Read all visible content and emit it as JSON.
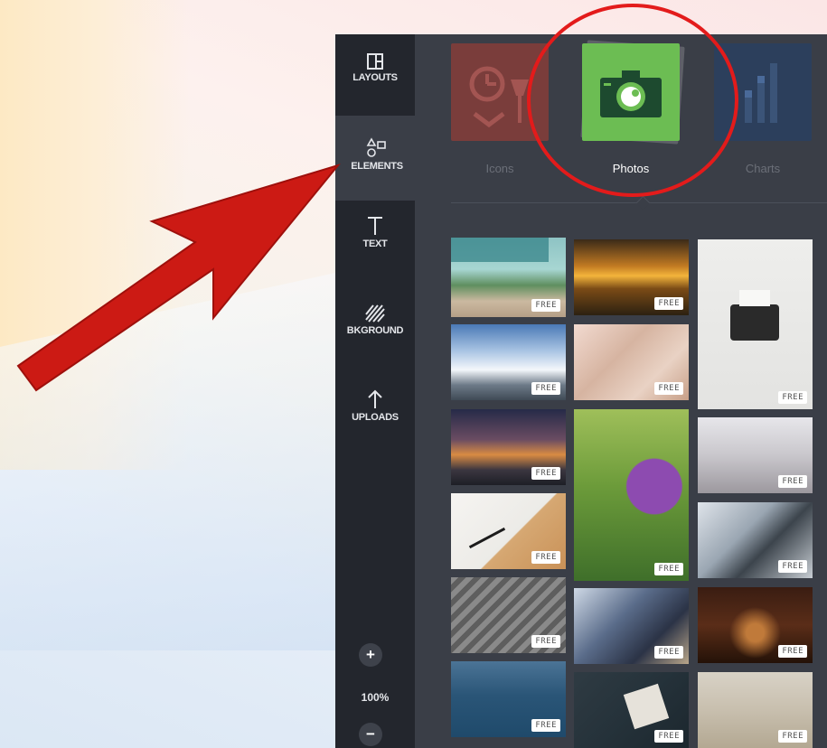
{
  "sidebar": {
    "items": [
      {
        "label": "LAYOUTS",
        "icon": "layouts-icon"
      },
      {
        "label": "ELEMENTS",
        "icon": "elements-icon"
      },
      {
        "label": "TEXT",
        "icon": "text-icon"
      },
      {
        "label": "BKGROUND",
        "icon": "background-icon"
      },
      {
        "label": "UPLOADS",
        "icon": "uploads-icon"
      }
    ],
    "active": "ELEMENTS",
    "zoom": {
      "in": "+",
      "out": "−",
      "level": "100%"
    }
  },
  "categories": [
    {
      "label": "Icons",
      "color": "#7a3d3b"
    },
    {
      "label": "Photos",
      "color": "#6cbd53",
      "selected": true
    },
    {
      "label": "Charts",
      "color": "#2c3f5c"
    }
  ],
  "photos": [
    {
      "badge": "FREE",
      "subject": "tropical-beach"
    },
    {
      "badge": "FREE",
      "subject": "sunset-lake"
    },
    {
      "badge": "FREE",
      "subject": "typewriter"
    },
    {
      "badge": "FREE",
      "subject": "city-clouds"
    },
    {
      "badge": "FREE",
      "subject": "dry-grass"
    },
    {
      "badge": "FREE",
      "subject": "dusk-skyline"
    },
    {
      "badge": "FREE",
      "subject": "lupine-bee"
    },
    {
      "badge": "FREE",
      "subject": "empty-room"
    },
    {
      "badge": "FREE",
      "subject": "notebook-pen"
    },
    {
      "badge": "FREE",
      "subject": "office-desk"
    },
    {
      "badge": "FREE",
      "subject": "rail-tracks"
    },
    {
      "badge": "FREE",
      "subject": "people-laptops"
    },
    {
      "badge": "FREE",
      "subject": "brick-arches"
    },
    {
      "badge": "FREE",
      "subject": "ocean-waves"
    },
    {
      "badge": "FREE",
      "subject": "laptop-desk"
    },
    {
      "badge": "FREE",
      "subject": "runner-road"
    }
  ],
  "annotation": {
    "arrow_color": "#cc1a14",
    "circle_color": "#e31b1b"
  }
}
